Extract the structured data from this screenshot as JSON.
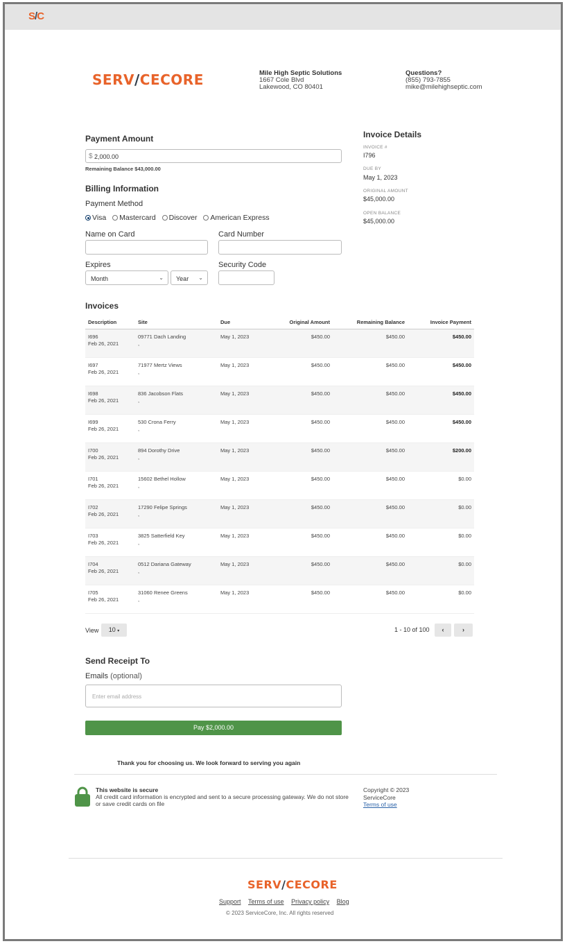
{
  "topbar": {
    "logo": "S C"
  },
  "header": {
    "brand": {
      "first": "SERV",
      "rest": "CE",
      "last": "CORE"
    },
    "company": {
      "name": "Mile High Septic Solutions",
      "address1": "1667 Cole Blvd",
      "address2": "Lakewood, CO 80401"
    },
    "contact": {
      "title": "Questions?",
      "phone": "(855) 793-7855",
      "email": "mike@milehighseptic.com"
    }
  },
  "payment": {
    "title": "Payment Amount",
    "currency": "$",
    "amount": "2,000.00",
    "remaining": "Remaining Balance $43,000.00"
  },
  "billing": {
    "title": "Billing Information",
    "method_label": "Payment Method",
    "methods": [
      "Visa",
      "Mastercard",
      "Discover",
      "American Express"
    ],
    "selected_method": "Visa",
    "name_label": "Name on Card",
    "number_label": "Card Number",
    "expires_label": "Expires",
    "month_value": "Month",
    "year_value": "Year",
    "security_label": "Security Code"
  },
  "details": {
    "title": "Invoice Details",
    "invoice_label": "INVOICE #",
    "invoice_value": "I796",
    "due_label": "DUE BY",
    "due_value": "May 1, 2023",
    "original_label": "ORIGINAL AMOUNT",
    "original_value": "$45,000.00",
    "open_label": "OPEN BALANCE",
    "open_value": "$45,000.00"
  },
  "invoices": {
    "title": "Invoices",
    "headers": [
      "Description",
      "Site",
      "Due",
      "Original Amount",
      "Remaining Balance",
      "Invoice Payment"
    ],
    "rows": [
      {
        "id": "I696",
        "date": "Feb 26, 2021",
        "site": "09771 Dach Landing",
        "sub": ",",
        "due": "May 1, 2023",
        "orig": "$450.00",
        "rem": "$450.00",
        "pay": "$450.00",
        "bold": true
      },
      {
        "id": "I697",
        "date": "Feb 26, 2021",
        "site": "71977 Mertz Views",
        "sub": ",",
        "due": "May 1, 2023",
        "orig": "$450.00",
        "rem": "$450.00",
        "pay": "$450.00",
        "bold": true
      },
      {
        "id": "I698",
        "date": "Feb 26, 2021",
        "site": "836 Jacobson Flats",
        "sub": ",",
        "due": "May 1, 2023",
        "orig": "$450.00",
        "rem": "$450.00",
        "pay": "$450.00",
        "bold": true
      },
      {
        "id": "I699",
        "date": "Feb 26, 2021",
        "site": "530 Crona Ferry",
        "sub": ",",
        "due": "May 1, 2023",
        "orig": "$450.00",
        "rem": "$450.00",
        "pay": "$450.00",
        "bold": true
      },
      {
        "id": "I700",
        "date": "Feb 26, 2021",
        "site": "894 Dorothy Drive",
        "sub": ",",
        "due": "May 1, 2023",
        "orig": "$450.00",
        "rem": "$450.00",
        "pay": "$200.00",
        "bold": true
      },
      {
        "id": "I701",
        "date": "Feb 26, 2021",
        "site": "15602 Bethel Hollow",
        "sub": ",",
        "due": "May 1, 2023",
        "orig": "$450.00",
        "rem": "$450.00",
        "pay": "$0.00",
        "bold": false
      },
      {
        "id": "I702",
        "date": "Feb 26, 2021",
        "site": "17290 Felipe Springs",
        "sub": ",",
        "due": "May 1, 2023",
        "orig": "$450.00",
        "rem": "$450.00",
        "pay": "$0.00",
        "bold": false
      },
      {
        "id": "I703",
        "date": "Feb 26, 2021",
        "site": "3825 Satterfield Key",
        "sub": ",",
        "due": "May 1, 2023",
        "orig": "$450.00",
        "rem": "$450.00",
        "pay": "$0.00",
        "bold": false
      },
      {
        "id": "I704",
        "date": "Feb 26, 2021",
        "site": "0512 Dariana Gateway",
        "sub": ",",
        "due": "May 1, 2023",
        "orig": "$450.00",
        "rem": "$450.00",
        "pay": "$0.00",
        "bold": false
      },
      {
        "id": "I705",
        "date": "Feb 26, 2021",
        "site": "31060 Renee Greens",
        "sub": ",",
        "due": "May 1, 2023",
        "orig": "$450.00",
        "rem": "$450.00",
        "pay": "$0.00",
        "bold": false
      }
    ],
    "view_label": "View",
    "view_value": "10",
    "range": "1 - 10 of 100"
  },
  "receipt": {
    "title": "Send Receipt To",
    "emails_label": "Emails",
    "emails_optional": "(optional)",
    "email_placeholder": "Enter email address",
    "pay_label": "Pay $2,000.00"
  },
  "footer": {
    "thanks": "Thank you for choosing us. We look forward to serving you again",
    "secure_title": "This website is secure",
    "secure_text": "All credit card information is encrypted and sent to a secure processing gateway. We do not store or save credit cards on file",
    "copyright_line1": "Copyright © 2023",
    "copyright_line2": "ServiceCore",
    "terms": "Terms of use",
    "links": [
      "Support",
      "Terms of use",
      "Privacy policy",
      "Blog"
    ],
    "bottom_copyright": "© 2023 ServiceCore, Inc. All rights reserved"
  },
  "colors": {
    "brand": "#e8632a",
    "pay_button": "#4f9448",
    "lock": "#4f9448",
    "link": "#2a62a8"
  }
}
